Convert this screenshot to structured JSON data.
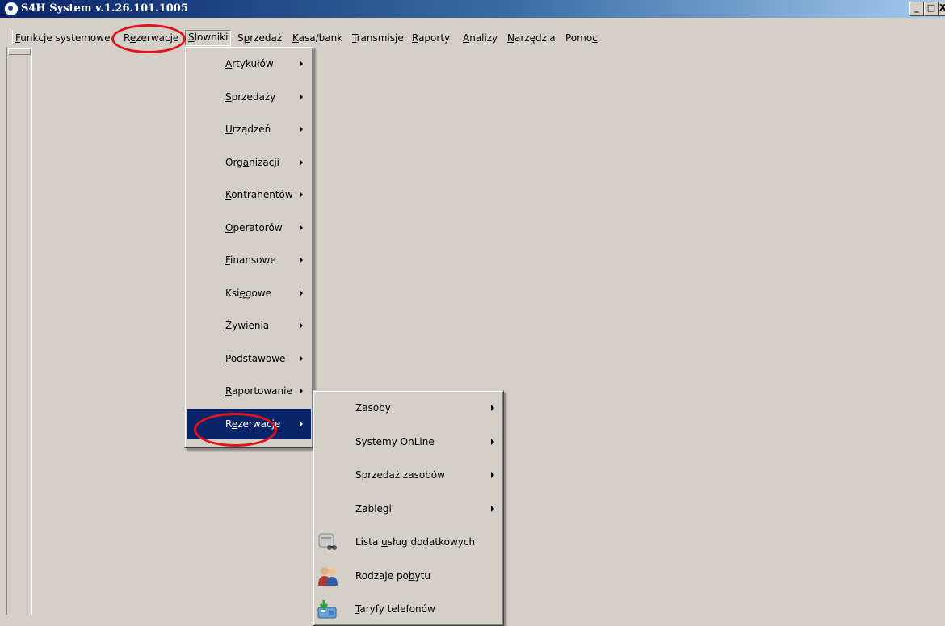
{
  "window": {
    "title": "S4H System v.1.26.101.1005",
    "controls": {
      "minimize": "_",
      "maximize": "□",
      "close": "X"
    }
  },
  "menubar": [
    {
      "pre": "",
      "u": "F",
      "post": "unkcje systemowe"
    },
    {
      "pre": "R",
      "u": "e",
      "post": "zerwacje"
    },
    {
      "pre": "",
      "u": "S",
      "post": "łowniki"
    },
    {
      "pre": "S",
      "u": "p",
      "post": "rzedaż"
    },
    {
      "pre": "",
      "u": "K",
      "post": "asa/bank"
    },
    {
      "pre": "",
      "u": "T",
      "post": "ransmisje"
    },
    {
      "pre": "",
      "u": "R",
      "post": "aporty"
    },
    {
      "pre": "",
      "u": "A",
      "post": "nalizy"
    },
    {
      "pre": "",
      "u": "N",
      "post": "arzędzia"
    },
    {
      "pre": "Pomo",
      "u": "c",
      "post": ""
    }
  ],
  "slowniki_menu": [
    {
      "pre": "",
      "u": "A",
      "post": "rtykułów"
    },
    {
      "pre": "",
      "u": "S",
      "post": "przedaży"
    },
    {
      "pre": "",
      "u": "U",
      "post": "rządzeń"
    },
    {
      "pre": "Org",
      "u": "a",
      "post": "nizacji"
    },
    {
      "pre": "",
      "u": "K",
      "post": "ontrahentów"
    },
    {
      "pre": "",
      "u": "O",
      "post": "peratorów"
    },
    {
      "pre": "",
      "u": "F",
      "post": "inansowe"
    },
    {
      "pre": "Ksi",
      "u": "ę",
      "post": "gowe"
    },
    {
      "pre": "",
      "u": "Ż",
      "post": "ywienia"
    },
    {
      "pre": "",
      "u": "P",
      "post": "odstawowe"
    },
    {
      "pre": "",
      "u": "R",
      "post": "aportowanie"
    },
    {
      "pre": "R",
      "u": "e",
      "post": "zerwacje"
    }
  ],
  "rezerwacje_submenu": [
    {
      "pre": "Zasoby",
      "u": "",
      "post": "",
      "arrow": true,
      "icon": ""
    },
    {
      "pre": "Systemy OnLine",
      "u": "",
      "post": "",
      "arrow": true,
      "icon": ""
    },
    {
      "pre": "Sprzedaż zasobów",
      "u": "",
      "post": "",
      "arrow": true,
      "icon": ""
    },
    {
      "pre": "Zabiegi",
      "u": "",
      "post": "",
      "arrow": true,
      "icon": ""
    },
    {
      "pre": "Lista ",
      "u": "u",
      "post": "sług dodatkowych",
      "arrow": false,
      "icon": "services-binoculars-icon"
    },
    {
      "pre": "Rodzaje po",
      "u": "b",
      "post": "ytu",
      "arrow": false,
      "icon": "people-icon"
    },
    {
      "pre": "",
      "u": "T",
      "post": "aryfy telefonów",
      "arrow": false,
      "icon": "phone-tariff-icon"
    }
  ],
  "colors": {
    "highlight": "#0a246a",
    "annotation": "#e1141b",
    "face": "#d4d0c8"
  }
}
